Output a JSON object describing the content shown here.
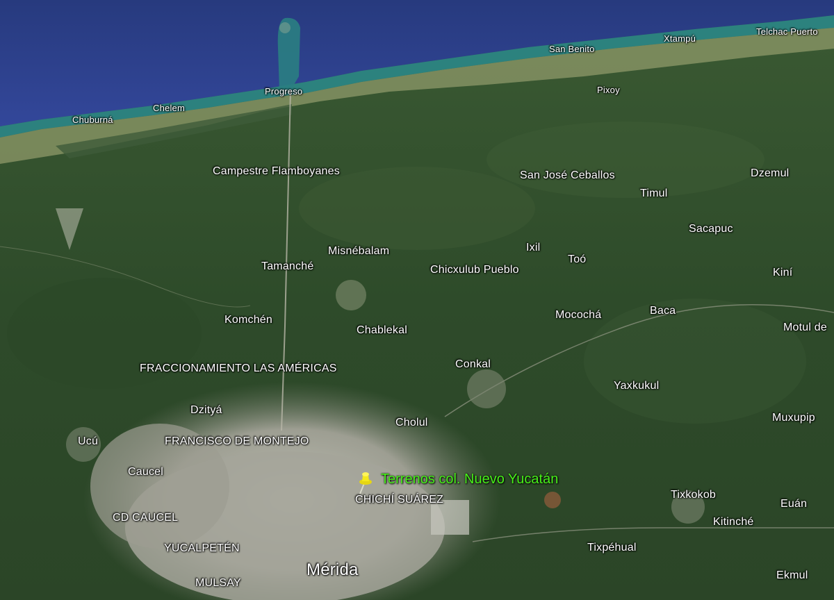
{
  "map": {
    "water_color": "#2e3f86",
    "land_color": "#2f4a2a",
    "urban_color": "#a9a9a0",
    "placemark_color": "#48f01a",
    "pin_color": "#f4e81c"
  },
  "coast_labels": {
    "telchac_puerto": "Telchac Puerto",
    "xtampu": "Xtampú",
    "san_benito": "San Benito",
    "progreso": "Progreso",
    "chelem": "Chelem",
    "chuburna": "Chuburná",
    "pixoy": "Pixoy"
  },
  "place_labels": {
    "campestre_flamboyanes": "Campestre Flamboyanes",
    "san_jose_ceballos": "San José Ceballos",
    "dzemul": "Dzemul",
    "timul": "Timul",
    "sacapuc": "Sacapuc",
    "misnebalam": "Misnébalam",
    "ixil": "Ixil",
    "too": "Toó",
    "tamanche": "Tamanché",
    "chicxulub_pueblo": "Chicxulub Pueblo",
    "kini": "Kiní",
    "mococha": "Mocochá",
    "baca": "Baca",
    "motul": "Motul de",
    "komchen": "Komchén",
    "chablekal": "Chablekal",
    "fracc_americas": "FRACCIONAMIENTO LAS AMÉRICAS",
    "conkal": "Conkal",
    "yaxkukul": "Yaxkukul",
    "dzitya": "Dzityá",
    "cholul": "Cholul",
    "muxupip": "Muxupip",
    "ucu": "Ucú",
    "francisco_montejo": "FRANCISCO DE MONTEJO",
    "caucel": "Caucel",
    "chichi_suarez": "CHICHÍ SUÁREZ",
    "tixkokob": "Tixkokob",
    "euan": "Euán",
    "cd_caucel": "CD CAUCEL",
    "kitinche": "Kitinché",
    "yucalpeten": "YUCALPETÉN",
    "tixpehual": "Tixpéhual",
    "merida": "Mérida",
    "mulsay": "MULSAY",
    "ekmul": "Ekmul"
  },
  "placemark": {
    "label": "Terrenos col. Nuevo Yucatán",
    "icon": "pushpin-icon"
  }
}
